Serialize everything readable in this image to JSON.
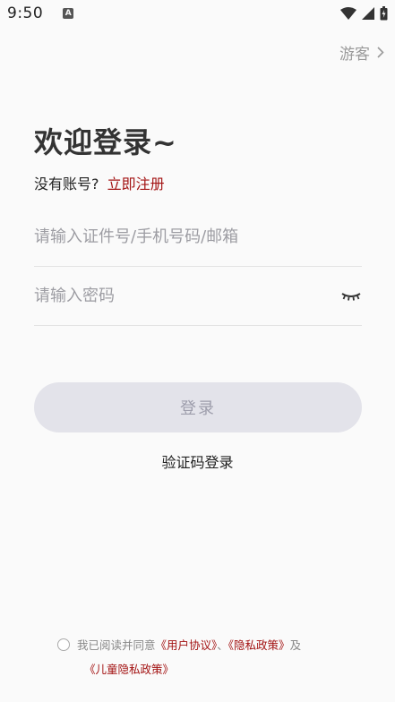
{
  "status_bar": {
    "time": "9:50",
    "notification_icon": "a-icon",
    "wifi_icon": "wifi-icon",
    "signal_icon": "signal-icon",
    "battery_icon": "battery-icon"
  },
  "header": {
    "guest_label": "游客",
    "guest_icon": "chevron-right-icon"
  },
  "main": {
    "title": "欢迎登录~",
    "no_account_text": "没有账号?",
    "register_link": "立即注册",
    "account_placeholder": "请输入证件号/手机号码/邮箱",
    "account_value": "",
    "password_placeholder": "请输入密码",
    "password_value": "",
    "password_toggle_icon": "eye-closed-icon",
    "login_button": "登录",
    "sms_login_link": "验证码登录"
  },
  "agreement": {
    "prefix": "我已阅读并同意",
    "user_agreement": "《用户协议》",
    "separator": "、",
    "privacy_policy": "《隐私政策》",
    "and": "及",
    "child_privacy_policy": "《儿童隐私政策》",
    "checked": false
  },
  "colors": {
    "accent_red": "#a31313",
    "button_disabled_bg": "#e3e3ea",
    "button_disabled_text": "#9d9dab",
    "placeholder": "#9d9da3",
    "background": "#fafafa"
  }
}
